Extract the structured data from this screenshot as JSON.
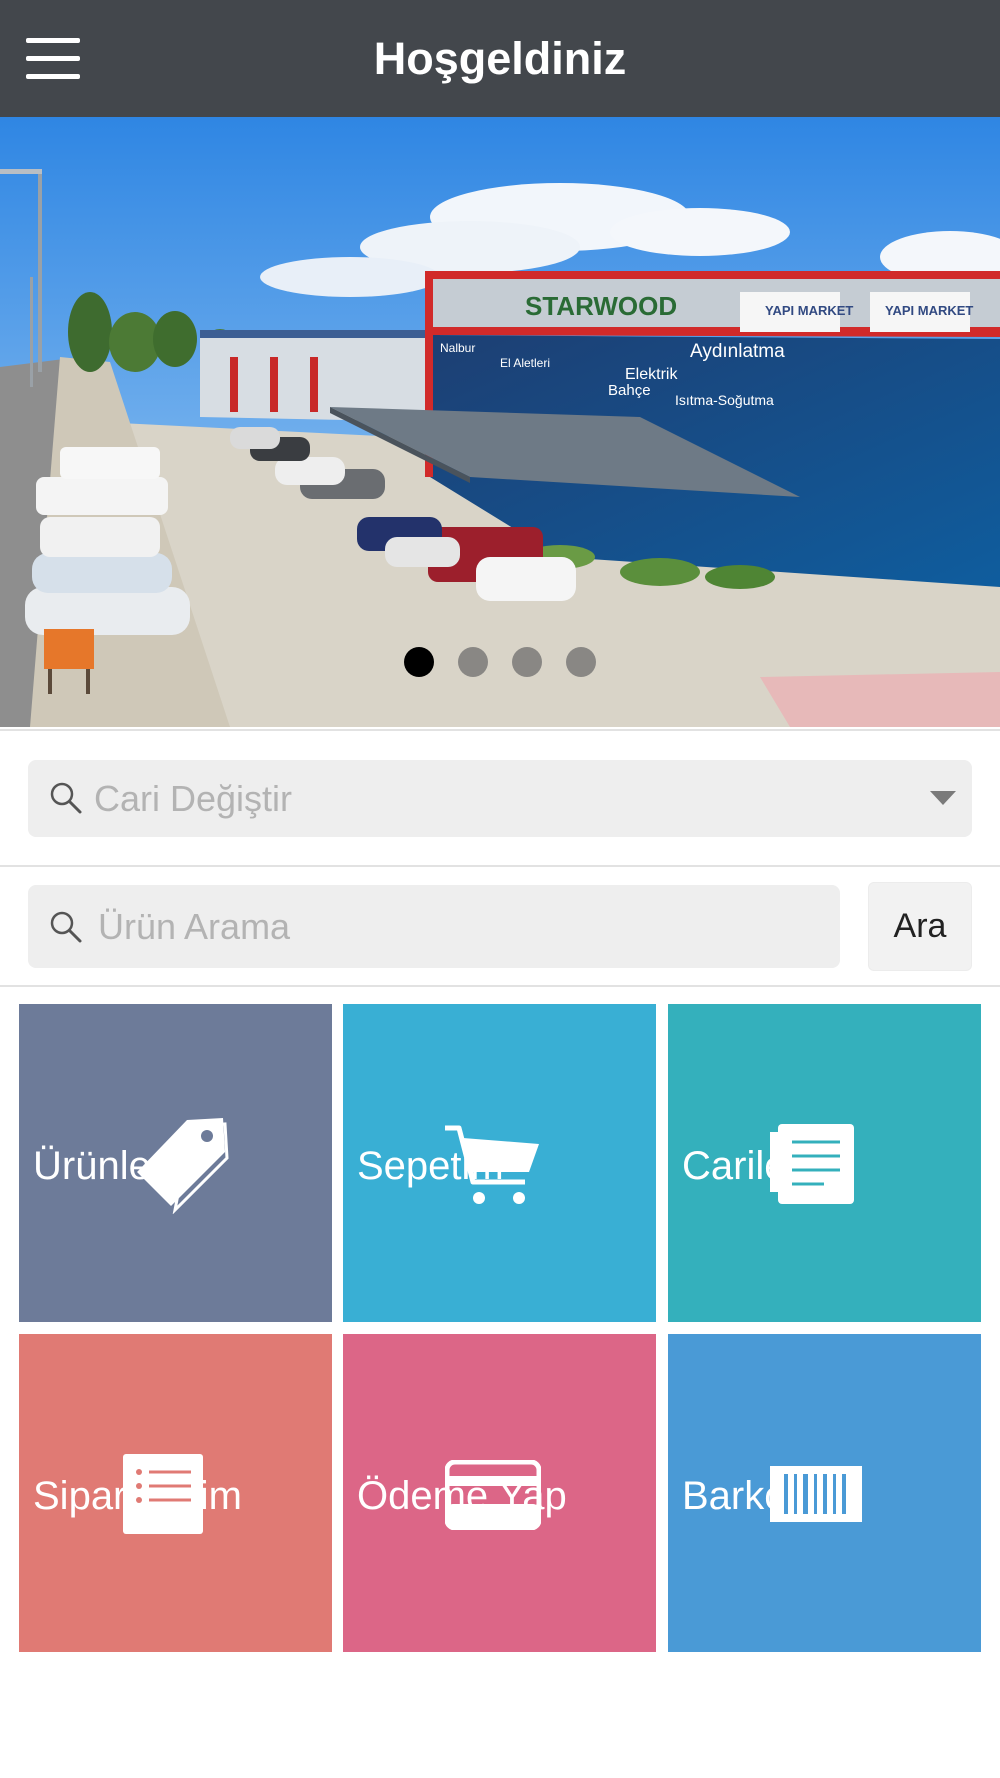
{
  "header": {
    "title": "Hoşgeldiniz",
    "menu_icon": "hamburger-menu-icon"
  },
  "carousel": {
    "sign_text": "STARWOOD",
    "store_labels": [
      "YAPI MARKET",
      "YAPI MARKET"
    ],
    "banner_texts": [
      "Aydınlatma",
      "Elektrik",
      "Bahçe",
      "Isıtma-Soğutma",
      "El Aletleri",
      "Nalbur"
    ],
    "slide_count": 4,
    "active_slide": 1
  },
  "cari_select": {
    "placeholder": "Cari Değiştir"
  },
  "product_search": {
    "placeholder": "Ürün Arama",
    "value": "",
    "button_label": "Ara"
  },
  "colors": {
    "header_bg": "#43474c",
    "tile_urunler": "#6d7b99",
    "tile_sepetim": "#39afd4",
    "tile_cariler": "#34b0bc",
    "tile_siparislerim": "#e07a74",
    "tile_odeme": "#dc6687",
    "tile_barkod": "#4a9ad6"
  },
  "tiles": [
    {
      "label": "Ürünler",
      "icon": "price-tag-icon"
    },
    {
      "label": "Sepetim",
      "icon": "shopping-cart-icon"
    },
    {
      "label": "Cariler",
      "icon": "document-list-icon"
    },
    {
      "label": "Siparişlerim",
      "icon": "order-list-icon"
    },
    {
      "label": "Ödeme Yap",
      "icon": "credit-card-icon"
    },
    {
      "label": "Barkod",
      "icon": "barcode-icon"
    }
  ]
}
